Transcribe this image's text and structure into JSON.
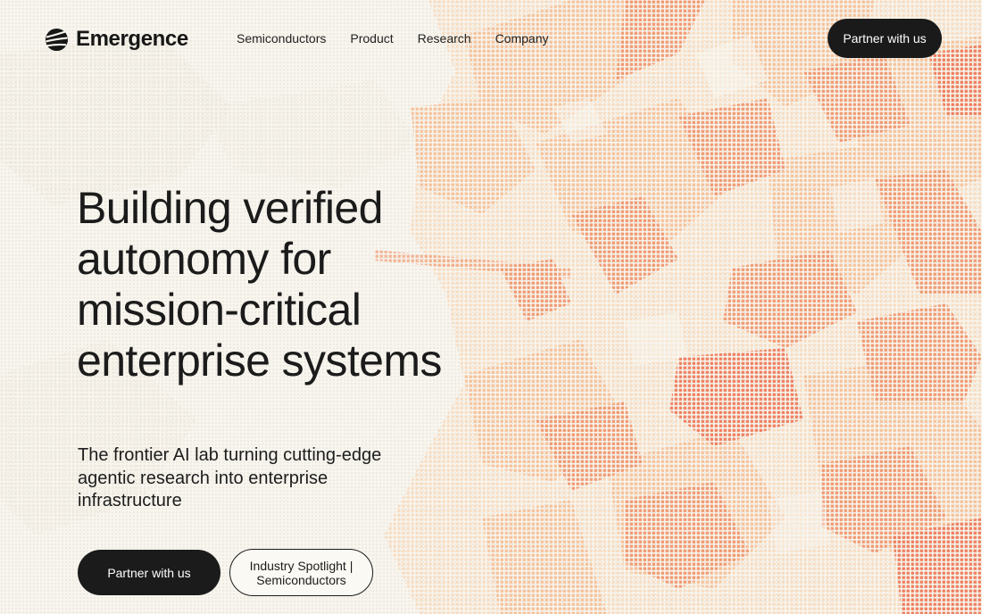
{
  "header": {
    "brand": "Emergence",
    "nav": [
      "Semiconductors",
      "Product",
      "Research",
      "Company"
    ],
    "cta_label": "Partner with us"
  },
  "hero": {
    "title_lines": [
      "Building verified",
      "autonomy for",
      "mission-critical",
      "enterprise systems"
    ],
    "subtitle_lines": [
      "The frontier AI lab turning cutting-edge",
      "agentic research into enterprise",
      "infrastructure"
    ],
    "primary_button": "Partner with us",
    "secondary_button_lines": [
      "Industry Spotlight |",
      "Semiconductors"
    ]
  },
  "colors": {
    "background": "#f8f5ee",
    "accent_orange": "#f29a72",
    "accent_peach": "#f6c9a6",
    "button_dark": "#1b1b1b"
  },
  "icons": {
    "logo": "emergence-logo-icon"
  }
}
